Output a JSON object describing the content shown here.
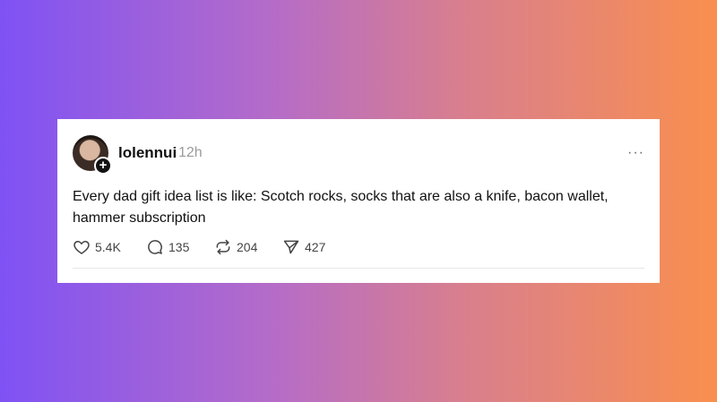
{
  "post": {
    "username": "lolennui",
    "time": "12h",
    "more_icon": "···",
    "text": "Every dad gift idea list is like: Scotch rocks, socks that are also a knife, bacon wallet, hammer subscription"
  },
  "actions": {
    "likes": "5.4K",
    "comments": "135",
    "reposts": "204",
    "shares": "427"
  },
  "colors": {
    "gradient_left": "#7f52f5",
    "gradient_right": "#f98f4e",
    "card": "#ffffff",
    "text": "#111111",
    "muted": "#9b9b9b"
  }
}
